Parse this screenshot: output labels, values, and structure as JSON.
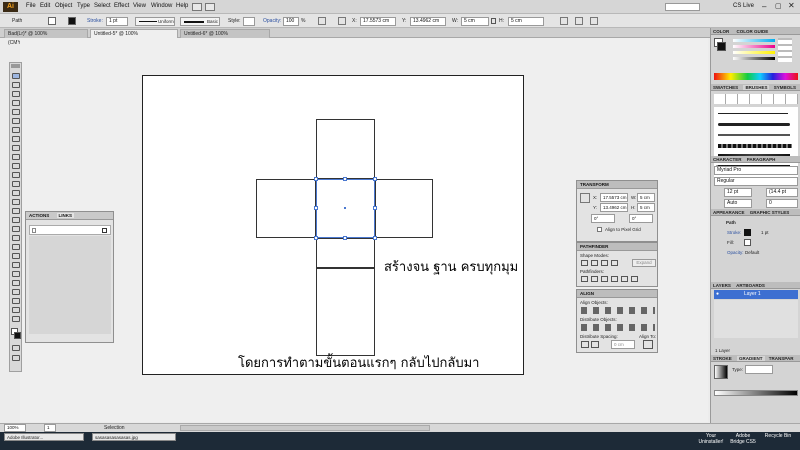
{
  "menubar": {
    "logo": "Ai",
    "items": [
      "File",
      "Edit",
      "Object",
      "Type",
      "Select",
      "Effect",
      "View",
      "Window",
      "Help"
    ],
    "cslive": "CS Live"
  },
  "control": {
    "selection": "Path",
    "stroke_label": "Stroke:",
    "stroke_value": "1 pt",
    "profile": "Uniform",
    "brush": "Basic",
    "style_label": "Style:",
    "opacity_label": "Opacity:",
    "opacity_value": "100",
    "opacity_unit": "%",
    "x_label": "X:",
    "x_value": "17.5573 cm",
    "y_label": "Y:",
    "y_value": "13.4962 cm",
    "w_label": "W:",
    "w_value": "5 cm",
    "h_label": "H:",
    "h_value": "5 cm"
  },
  "tabs": [
    "Bad(Lr)* @ 100% (CMYK/Preview)",
    "Untitled-5* @ 100% (CMYK/Preview)",
    "Untitled-6* @ 100% (CMYK/Preview)"
  ],
  "canvas": {
    "caption_right": "สร้างจน ฐาน ครบทุกมุม",
    "caption_bottom": "โดยการทำตามขั้นตอนแรกๆ กลับไปกลับมา"
  },
  "actions_panel": {
    "tab1": "ACTIONS",
    "tab2": "LINKS"
  },
  "transform_panel": {
    "title": "TRANSFORM",
    "x_label": "X:",
    "x_value": "17.5573 cm",
    "y_label": "Y:",
    "y_value": "13.4962 cm",
    "w_label": "W:",
    "w_value": "5 cm",
    "h_label": "H:",
    "h_value": "5 cm",
    "rotate_value": "0°",
    "shear_value": "0°",
    "align_pixel": "Align to Pixel Grid"
  },
  "pathfinder_panel": {
    "title": "PATHFINDER",
    "shape_modes": "Shape Modes:",
    "expand": "Expand",
    "pathfinders": "Pathfinders:"
  },
  "align_panel": {
    "title": "ALIGN",
    "align_objects": "Align Objects:",
    "distribute_objects": "Distribute Objects:",
    "distribute_spacing": "Distribute Spacing:",
    "align_to": "Align To:",
    "spacing_value": "0 cm"
  },
  "right_dock": {
    "color_tab": "COLOR",
    "color_guide_tab": "COLOR GUIDE",
    "swatches_tab": "SWATCHES",
    "brushes_tab": "BRUSHES",
    "symbols_tab": "SYMBOLS",
    "character_tab": "CHARACTER",
    "paragraph_tab": "PARAGRAPH",
    "opentype_tab": "OPENTYPE",
    "font": "Myriad Pro",
    "font_style": "Regular",
    "font_size": "12 pt",
    "leading": "(14.4 pt",
    "kerning": "Auto",
    "tracking": "0",
    "appearance_tab": "APPEARANCE",
    "graphic_styles_tab": "GRAPHIC STYLES",
    "appearance_title": "Path",
    "stroke_label": "Stroke:",
    "stroke_value": "1 pt",
    "fill_label": "Fill:",
    "opacity_label": "Opacity:",
    "opacity_value": "Default",
    "layers_tab": "LAYERS",
    "artboards_tab": "ARTBOARDS",
    "layer_name": "Layer 1",
    "layer_count": "1 Layer",
    "stroke_tab": "STROKE",
    "gradient_tab": "GRADIENT",
    "transparency_tab": "TRANSPAR",
    "type_label": "Type:"
  },
  "status": {
    "zoom": "100%",
    "artboard_num": "1",
    "tool": "Selection"
  },
  "taskbar": {
    "items": [
      "Adobe Illustrator...",
      "sasasasasasasas.jpg"
    ],
    "desktop_icons": [
      "Your Uninstaller!",
      "Adobe Bridge CS5",
      "Recycle Bin"
    ]
  },
  "colors": {
    "selection_blue": "#4a78d0",
    "layer_blue": "#3d6fd1",
    "ai_orange": "#f6a21c"
  }
}
